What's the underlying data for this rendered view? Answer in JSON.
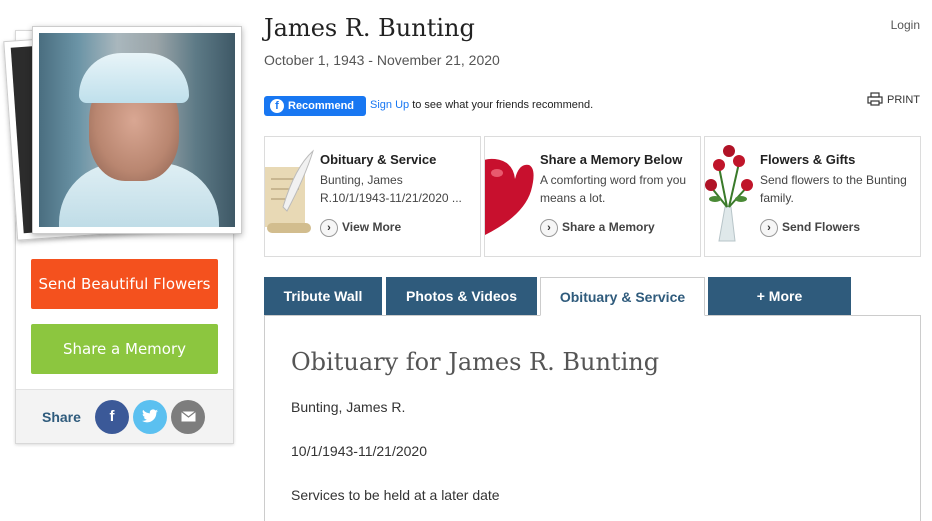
{
  "header": {
    "name": "James R. Bunting",
    "dates": "October 1, 1943 - November 21, 2020",
    "login": "Login"
  },
  "facebook": {
    "button_label": "Recommend",
    "signup_link": "Sign Up",
    "signup_text": " to see what your friends recommend."
  },
  "print_label": "PRINT",
  "left_panel": {
    "send_flowers_label": "Send Beautiful Flowers",
    "share_memory_label": "Share a Memory",
    "share_label": "Share"
  },
  "cards": [
    {
      "title": "Obituary & Service",
      "desc": "Bunting, James R.10/1/1943-11/21/2020 ...",
      "link": "View More"
    },
    {
      "title": "Share a Memory Below",
      "desc": "A comforting word from you means a lot.",
      "link": "Share a Memory"
    },
    {
      "title": "Flowers & Gifts",
      "desc": "Send flowers to the Bunting family.",
      "link": "Send Flowers"
    }
  ],
  "tabs": [
    {
      "label": "Tribute Wall"
    },
    {
      "label": "Photos & Videos"
    },
    {
      "label": "Obituary & Service"
    },
    {
      "label": "+ More"
    }
  ],
  "obituary": {
    "title": "Obituary for James R. Bunting",
    "lines": [
      "Bunting, James R.",
      "10/1/1943-11/21/2020",
      "Services to be held at a later date"
    ]
  },
  "colors": {
    "flowers_button": "#f4511e",
    "memory_button": "#8cc63f",
    "tab_bg": "#2f5b7c",
    "facebook": "#1877f2"
  }
}
